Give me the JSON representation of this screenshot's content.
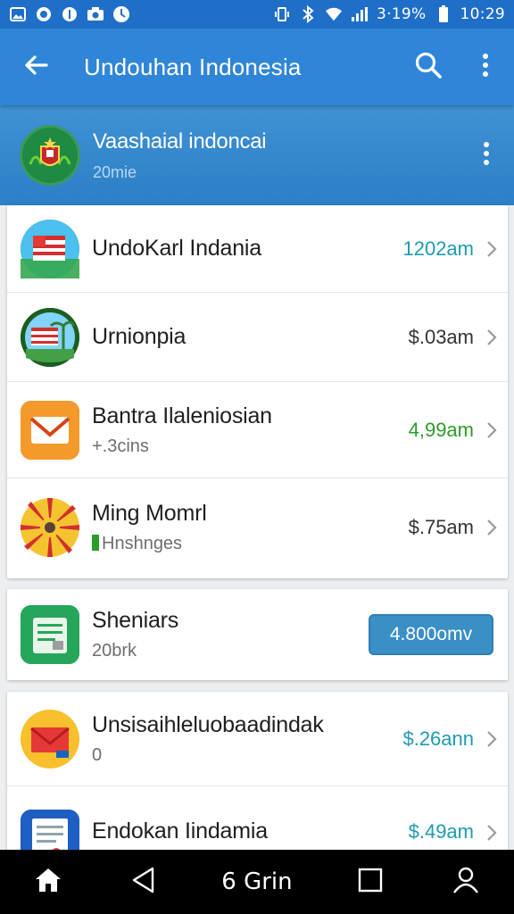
{
  "status_bar": {
    "left_icons": [
      "image-icon",
      "circle-notif-icon",
      "circle-info-icon",
      "camera-icon",
      "clock-icon"
    ],
    "battery_text": "3·19%",
    "time": "10:29"
  },
  "app_bar": {
    "title": "Undouhan Indonesia",
    "back_icon": "back-arrow-icon",
    "search_icon": "search-icon",
    "more_icon": "more-vert-icon"
  },
  "featured": {
    "name": "Vaashaial indoncai",
    "sub": "20mie"
  },
  "list": {
    "card1": [
      {
        "name": "UndoKarl Indania",
        "sub": "",
        "amount": "1202am",
        "amount_color": "#1d9bb0",
        "icon": "flag-icon"
      },
      {
        "name": "Urnionpia",
        "sub": "",
        "amount": "$.03am",
        "amount_color": "#333333",
        "icon": "flag-island-icon"
      },
      {
        "name": "Bantra Ilaleniosian",
        "sub": "+.3cins",
        "amount": "4,99am",
        "amount_color": "#2c9c2a",
        "icon": "mail-icon"
      },
      {
        "name": "Ming Momrl",
        "sub": "Hnshnges",
        "amount": "$.75am",
        "amount_color": "#333333",
        "icon": "sunburst-icon"
      }
    ],
    "card2": [
      {
        "name": "Sheniars",
        "sub": "20brk",
        "button": "4.800omv",
        "icon": "document-icon"
      }
    ],
    "card3": [
      {
        "name": "Unsisaihleluobaadindak",
        "sub": "0",
        "amount": "$.26ann",
        "amount_color": "#1d9bb0",
        "icon": "envelope-icon"
      },
      {
        "name": "Endokan Iindamia",
        "sub": "",
        "amount": "$.49am",
        "amount_color": "#1d9bb0",
        "icon": "notes-icon"
      }
    ]
  },
  "nav_bar": {
    "center_text": "6 Grin",
    "icons": [
      "home-icon",
      "back-triangle-icon",
      "recents-square-icon",
      "profile-icon"
    ]
  },
  "colors": {
    "primary": "#2f86d8",
    "status_bar": "#1f6fc8",
    "accent_button": "#3a8fc5"
  }
}
